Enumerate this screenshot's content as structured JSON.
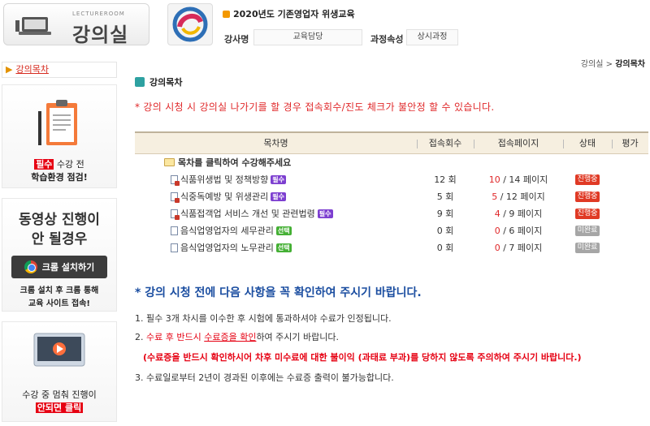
{
  "header": {
    "logo_sub": "LECTUREROOM",
    "logo_title": "강의실",
    "course_title": "2020년도 기존영업자 위생교육",
    "instructor_label": "강사명",
    "instructor_value": "교육담당",
    "course_type_label": "과정속성",
    "course_type_value": "상시과정"
  },
  "sidebar": {
    "tab_label": "강의목차",
    "card1": {
      "tag": "필수",
      "line1_rest": " 수강 전",
      "line2": "학습환경 점검!"
    },
    "card2": {
      "line1": "동영상 진행이",
      "line2": "안 될경우",
      "button": "크롬 설치하기",
      "desc1": "크롬 설치 후 크롬 통해",
      "desc2": "교육 사이트 접속!"
    },
    "card3": {
      "line1": "수강 중 멈춰 진행이",
      "tag": "안되면 클릭"
    }
  },
  "breadcrumb": {
    "root": "강의실",
    "sep": " > ",
    "current": "강의목차"
  },
  "main": {
    "section_title": "강의목차",
    "warning": "* 강의 시청 시 강의실 나가기를 할 경우 접속회수/진도 체크가 불안정 할 수 있습니다.",
    "table": {
      "headers": [
        "목차명",
        "접속회수",
        "접속페이지",
        "상태",
        "평가"
      ],
      "folder_row": "목차를 클릭하여 수강해주세요",
      "rows": [
        {
          "title": "식품위생법 및 정책방향",
          "badge": "필수",
          "count": "12 회",
          "page_cur": "10",
          "page_total": " / 14 페이지",
          "status": "진행중"
        },
        {
          "title": "식중독예방 및 위생관리",
          "badge": "필수",
          "count": "5 회",
          "page_cur": "5",
          "page_total": " / 12 페이지",
          "status": "진행중"
        },
        {
          "title": "식품접객업 서비스 개선 및 관련법령",
          "badge": "필수",
          "count": "9 회",
          "page_cur": "4",
          "page_total": " / 9 페이지",
          "status": "진행중"
        },
        {
          "title": "음식업영업자의 세무관리",
          "badge": "선택",
          "count": "0 회",
          "page_cur": "0",
          "page_total": " / 6 페이지",
          "status": "미완료"
        },
        {
          "title": "음식업영업자의 노무관리",
          "badge": "선택",
          "count": "0 회",
          "page_cur": "0",
          "page_total": " / 7 페이지",
          "status": "미완료"
        }
      ]
    },
    "notice_title": "* 강의 시청 전에 다음 사항을 꼭 확인하여 주시기 바랍니다.",
    "notices": {
      "n1": "1. 필수 3개 차시를 이수한 후 시험에 통과하셔야 수료가 인정됩니다.",
      "n2_prefix": "2. ",
      "n2_red": "수료 후 반드시 ",
      "n2_red_u": "수료증을 확인",
      "n2_rest": "하여 주시기 바랍니다.",
      "n3": "(수료증을 반드시 확인하시어 차후 미수료에 대한 불이익 (과태료 부과)를 당하지 않도록 주의하여 주시기 바랍니다.)",
      "n4": "3. 수료일로부터 2년이 경과된 이후에는 수료증 출력이 불가능합니다."
    }
  },
  "colors": {
    "accent_red": "#e60012",
    "notice_blue": "#1a4da0",
    "status_active": "#e03a25",
    "status_inactive": "#a6a6a6",
    "badge_required": "#7d3fd0",
    "badge_optional": "#45b035"
  }
}
